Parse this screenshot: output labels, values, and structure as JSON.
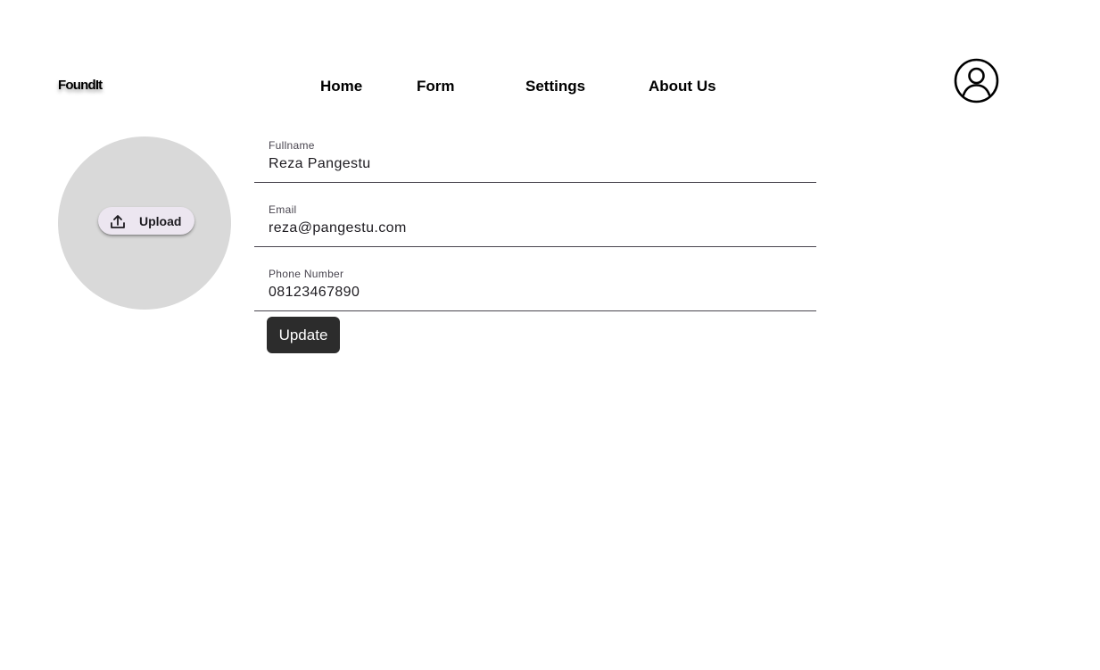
{
  "header": {
    "logo_text": "FoundIt",
    "nav": {
      "home": "Home",
      "form": "Form",
      "settings": "Settings",
      "about": "About Us"
    },
    "profile_icon": "account-circle-icon"
  },
  "avatar": {
    "upload_icon": "upload-icon",
    "upload_label": "Upload"
  },
  "form": {
    "fullname": {
      "label": "Fullname",
      "value": "Reza Pangestu"
    },
    "email": {
      "label": "Email",
      "value": "reza@pangestu.com"
    },
    "phone": {
      "label": "Phone Number",
      "value": "08123467890"
    },
    "update_label": "Update"
  },
  "colors": {
    "avatar_bg": "#d9d9d9",
    "upload_bg": "#ece6f0",
    "button_bg": "#2c2c2c",
    "underline": "#49454f"
  }
}
